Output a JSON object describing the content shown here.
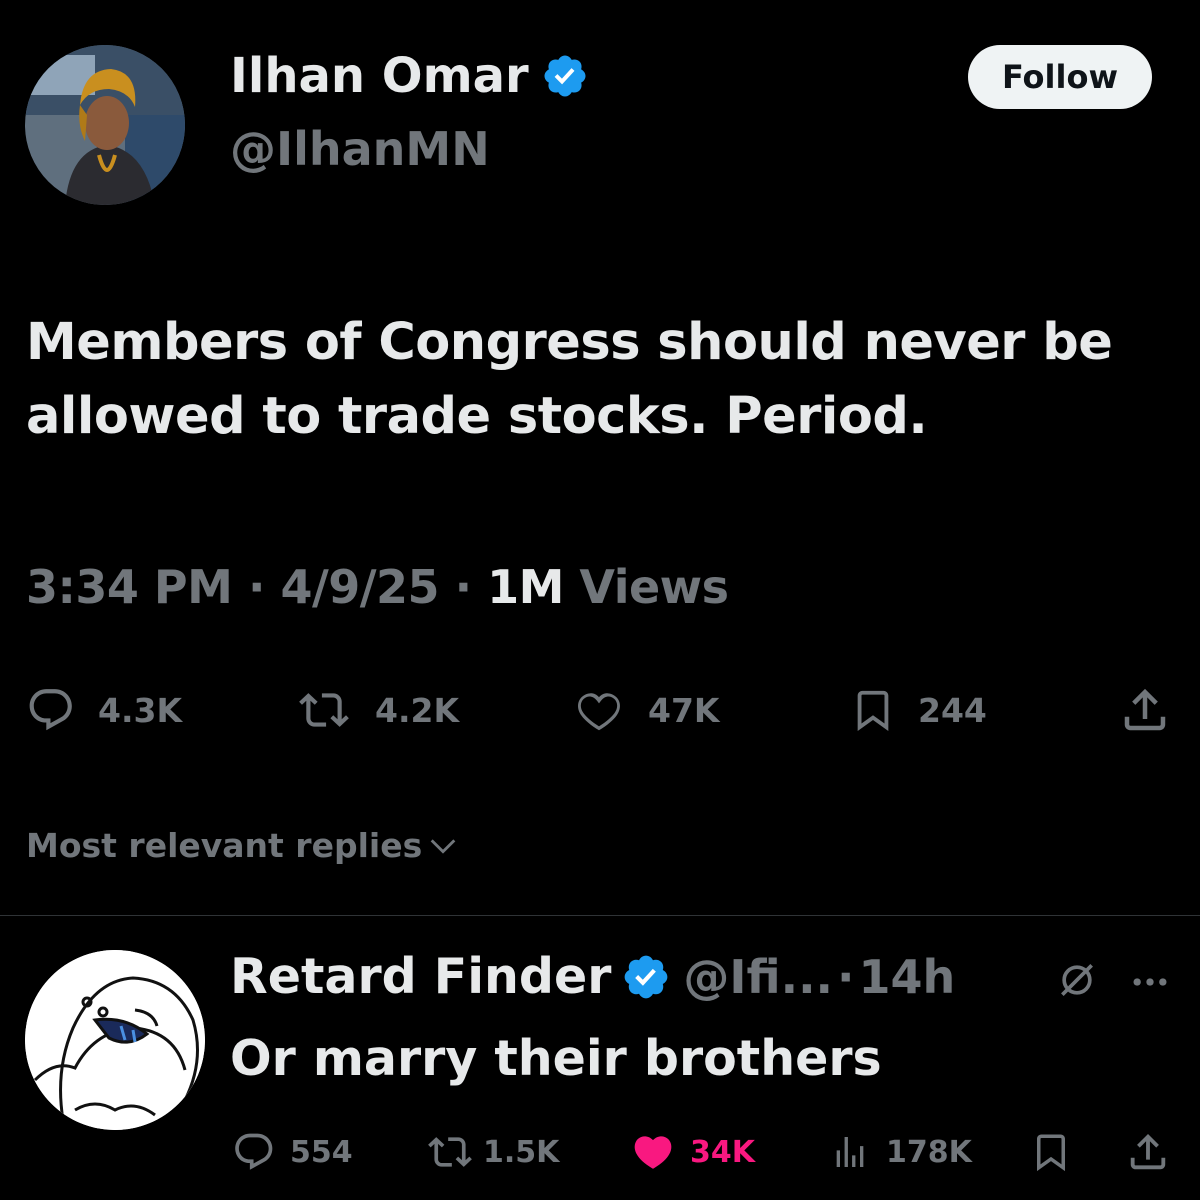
{
  "tweet": {
    "author_name": "Ilhan Omar",
    "handle": "@IlhanMN",
    "follow_label": "Follow",
    "text": "Members of Congress should never be allowed to trade stocks. Period.",
    "time": "3:34 PM",
    "date": "4/9/25",
    "views_count": "1M",
    "views_label": "Views",
    "separator": "·",
    "stats": {
      "replies": "4.3K",
      "reposts": "4.2K",
      "likes": "47K",
      "bookmarks": "244"
    }
  },
  "replies_section": {
    "sort_label": "Most relevant replies"
  },
  "reply": {
    "author_name": "Retard Finder",
    "handle": "@Ifi...",
    "separator": "·",
    "time": "14h",
    "text": "Or marry their brothers",
    "stats": {
      "replies": "554",
      "reposts": "1.5K",
      "likes": "34K",
      "views": "178K"
    }
  },
  "colors": {
    "background": "#000000",
    "verified": "#1d9bf0",
    "liked": "#f91880",
    "secondary_text": "#71767b",
    "primary_text": "#e7e9ea"
  },
  "icons": [
    "verified-badge-icon",
    "reply-icon",
    "repost-icon",
    "like-icon",
    "bookmark-icon",
    "share-icon",
    "chevron-down-icon",
    "grok-icon",
    "more-icon",
    "views-icon"
  ]
}
